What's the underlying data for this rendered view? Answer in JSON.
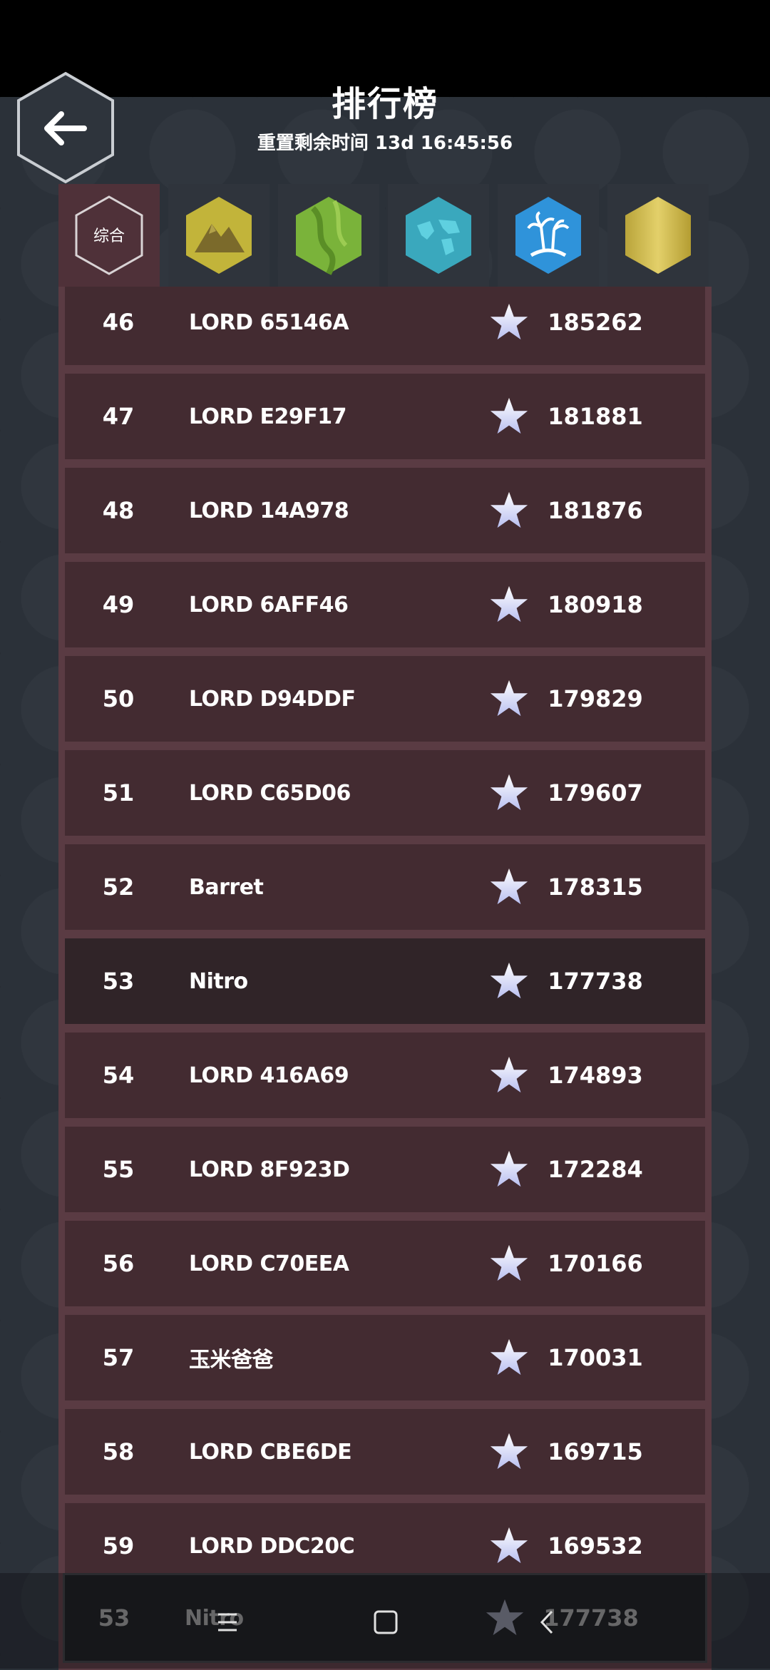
{
  "header": {
    "title": "排行榜",
    "reset_label": "重置剩余时间 13d 16:45:56"
  },
  "tabs": [
    {
      "label": "综合",
      "icon": "overall-hex-icon",
      "active": true
    },
    {
      "icon": "mountain-hex-icon"
    },
    {
      "icon": "grassland-hex-icon"
    },
    {
      "icon": "world-map-hex-icon"
    },
    {
      "icon": "palm-island-hex-icon"
    },
    {
      "icon": "gold-hex-icon"
    }
  ],
  "rows": [
    {
      "rank": "46",
      "name": "LORD 65146A",
      "score": "185262"
    },
    {
      "rank": "47",
      "name": "LORD E29F17",
      "score": "181881"
    },
    {
      "rank": "48",
      "name": "LORD 14A978",
      "score": "181876"
    },
    {
      "rank": "49",
      "name": "LORD 6AFF46",
      "score": "180918"
    },
    {
      "rank": "50",
      "name": "LORD D94DDF",
      "score": "179829"
    },
    {
      "rank": "51",
      "name": "LORD C65D06",
      "score": "179607"
    },
    {
      "rank": "52",
      "name": "Barret",
      "score": "178315"
    },
    {
      "rank": "53",
      "name": "Nitro",
      "score": "177738",
      "current": true
    },
    {
      "rank": "54",
      "name": "LORD 416A69",
      "score": "174893"
    },
    {
      "rank": "55",
      "name": "LORD 8F923D",
      "score": "172284"
    },
    {
      "rank": "56",
      "name": "LORD C70EEA",
      "score": "170166"
    },
    {
      "rank": "57",
      "name": "玉米爸爸",
      "score": "170031"
    },
    {
      "rank": "58",
      "name": "LORD CBE6DE",
      "score": "169715"
    },
    {
      "rank": "59",
      "name": "LORD DDC20C",
      "score": "169532"
    }
  ],
  "current_player": {
    "rank": "53",
    "name": "Nitro",
    "score": "177738"
  },
  "colors": {
    "panel": "#5a3b43",
    "row": "#432b31",
    "current_row": "#302428",
    "background": "#2b3139"
  }
}
